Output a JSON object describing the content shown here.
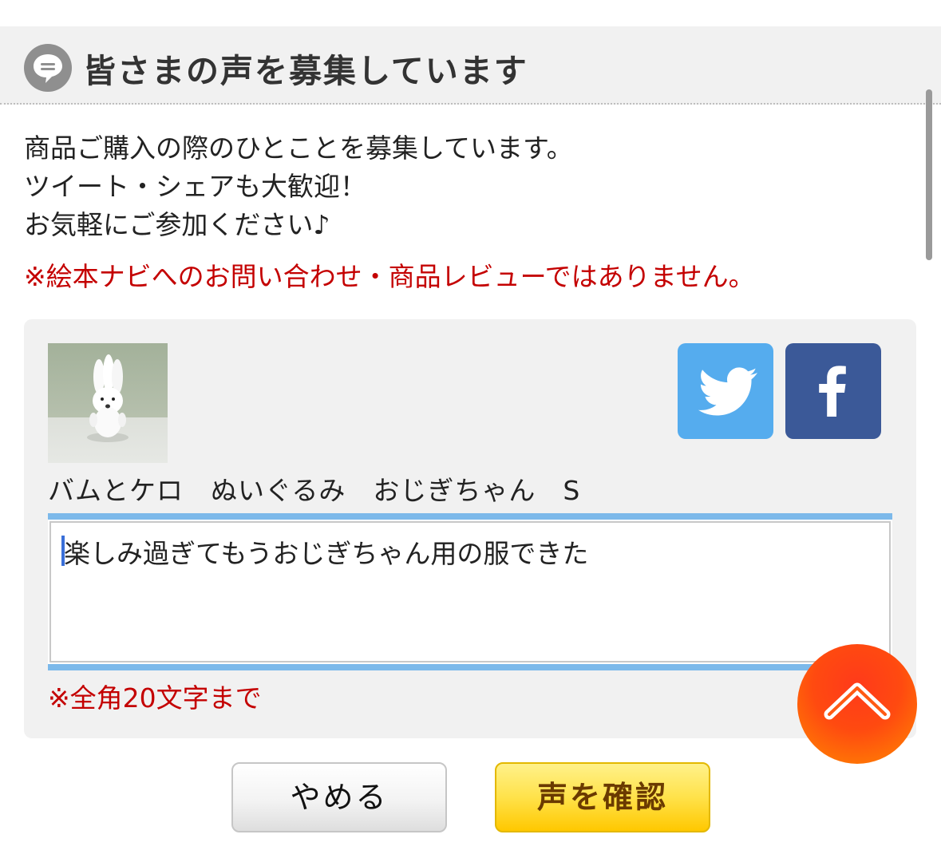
{
  "header": {
    "title": "皆さまの声を募集しています",
    "icon": "speech-bubble-icon"
  },
  "intro": {
    "lines": [
      "商品ご購入の際のひとことを募集しています。",
      "ツイート・シェアも大歓迎！",
      "お気軽にご参加ください♪"
    ],
    "notice": "※絵本ナビへのお問い合わせ・商品レビューではありません。"
  },
  "product": {
    "name": "バムとケロ　ぬいぐるみ　おじぎちゃん　S",
    "thumbnail": "plush-rabbit-photo"
  },
  "share": {
    "twitter_icon": "twitter-icon",
    "facebook_icon": "facebook-icon"
  },
  "comment": {
    "value": "楽しみ過ぎてもうおじぎちゃん用の服できた",
    "limit_note": "※全角20文字まで"
  },
  "buttons": {
    "cancel_label": "やめる",
    "confirm_label": "声を確認"
  },
  "colors": {
    "notice_red": "#c40000",
    "twitter_blue": "#55acee",
    "facebook_blue": "#3b5998",
    "input_border_blue": "#7cb9ea",
    "confirm_yellow": "#ffe24a",
    "scroll_top_orange": "#ff4a10"
  }
}
